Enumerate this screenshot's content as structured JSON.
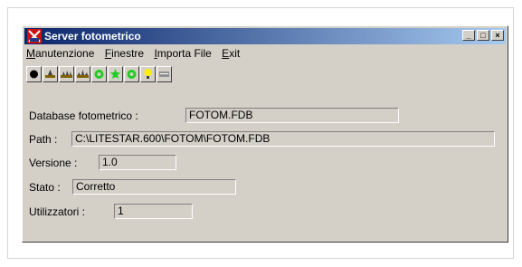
{
  "window": {
    "title": "Server fotometrico"
  },
  "titlebar_buttons": {
    "minimize": "_",
    "maximize": "□",
    "close": "×"
  },
  "menu": [
    {
      "underline": "M",
      "rest": "anutenzione"
    },
    {
      "underline": "F",
      "rest": "inestre"
    },
    {
      "underline": "I",
      "rest": "mporta File"
    },
    {
      "underline": "E",
      "rest": "xit"
    }
  ],
  "toolbar": [
    "record-icon",
    "database-icon",
    "database-icon",
    "database-icon",
    "gear-icon",
    "gear-icon",
    "gear-icon",
    "lightbulb-icon",
    "panel-icon"
  ],
  "fields": {
    "database": {
      "label": "Database fotometrico :",
      "value": "FOTOM.FDB"
    },
    "path": {
      "label": "Path :",
      "value": "C:\\LITESTAR.600\\FOTOM\\FOTOM.FDB"
    },
    "version": {
      "label": "Versione :",
      "value": "1.0"
    },
    "state": {
      "label": "Stato :",
      "value": "Corretto"
    },
    "users": {
      "label": "Utilizzatori :",
      "value": "1"
    }
  },
  "colors": {
    "titlebar_start": "#0a246a",
    "titlebar_end": "#a6caf0",
    "window_bg": "#d4d0c8"
  }
}
